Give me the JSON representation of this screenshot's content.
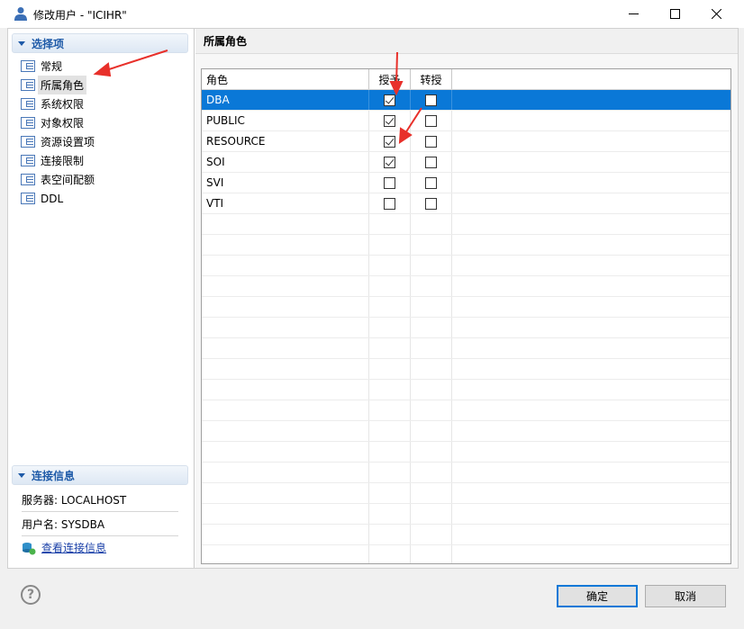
{
  "window": {
    "title": "修改用户 - \"ICIHR\"",
    "controls": {
      "minimize": "—",
      "maximize": "☐",
      "close": "✕"
    }
  },
  "sidebar": {
    "options_header": "选择项",
    "items": [
      {
        "label": "常规",
        "selected": false
      },
      {
        "label": "所属角色",
        "selected": true
      },
      {
        "label": "系统权限",
        "selected": false
      },
      {
        "label": "对象权限",
        "selected": false
      },
      {
        "label": "资源设置项",
        "selected": false
      },
      {
        "label": "连接限制",
        "selected": false
      },
      {
        "label": "表空间配额",
        "selected": false
      },
      {
        "label": "DDL",
        "selected": false
      }
    ],
    "connection_header": "连接信息",
    "server_label": "服务器: LOCALHOST",
    "user_label": "用户名: SYSDBA",
    "view_link": "查看连接信息"
  },
  "main": {
    "title": "所属角色",
    "columns": {
      "role": "角色",
      "grant": "授予",
      "admin": "转授"
    },
    "rows": [
      {
        "role": "DBA",
        "grant": true,
        "admin": false,
        "selected": true
      },
      {
        "role": "PUBLIC",
        "grant": true,
        "admin": false,
        "selected": false
      },
      {
        "role": "RESOURCE",
        "grant": true,
        "admin": false,
        "selected": false
      },
      {
        "role": "SOI",
        "grant": true,
        "admin": false,
        "selected": false
      },
      {
        "role": "SVI",
        "grant": false,
        "admin": false,
        "selected": false
      },
      {
        "role": "VTI",
        "grant": false,
        "admin": false,
        "selected": false
      }
    ]
  },
  "footer": {
    "help": "?",
    "ok_label": "确定",
    "cancel_label": "取消"
  },
  "colors": {
    "selection": "#0a78d7",
    "header_text": "#1e5aa8",
    "annotation_arrow": "#e8302a"
  }
}
